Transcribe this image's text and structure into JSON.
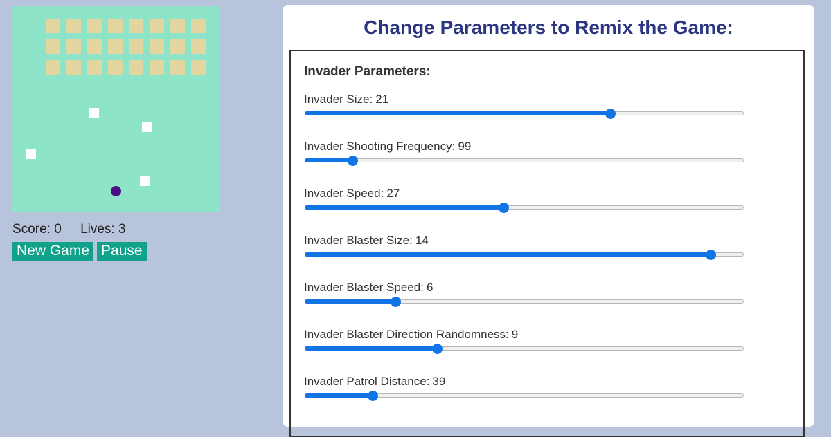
{
  "colors": {
    "page_bg": "#b8c3dc",
    "game_bg": "#8ee4c9",
    "invader": "#e2d59f",
    "blast": "#ffffff",
    "player": "#4b0f82",
    "button_bg": "#10a38a",
    "title_text": "#2b3580",
    "slider_accent": "#1175e5"
  },
  "game": {
    "invader_rows": 3,
    "invader_cols": 8,
    "status": {
      "score_label": "Score:",
      "score": "0",
      "lives_label": "Lives:",
      "lives": "3"
    },
    "buttons": {
      "new_game": "New Game",
      "pause": "Pause"
    }
  },
  "panel": {
    "title": "Change Parameters to Remix the Game:",
    "section_title": "Invader Parameters:",
    "params": [
      {
        "label": "Invader Size:",
        "value": "21",
        "fraction": 0.696
      },
      {
        "label": "Invader Shooting Frequency:",
        "value": "99",
        "fraction": 0.109
      },
      {
        "label": "Invader Speed:",
        "value": "27",
        "fraction": 0.452
      },
      {
        "label": "Invader Blaster Size:",
        "value": "14",
        "fraction": 0.924
      },
      {
        "label": "Invader Blaster Speed:",
        "value": "6",
        "fraction": 0.206
      },
      {
        "label": "Invader Blaster Direction Randomness:",
        "value": "9",
        "fraction": 0.302
      },
      {
        "label": "Invader Patrol Distance:",
        "value": "39",
        "fraction": 0.155
      }
    ]
  }
}
